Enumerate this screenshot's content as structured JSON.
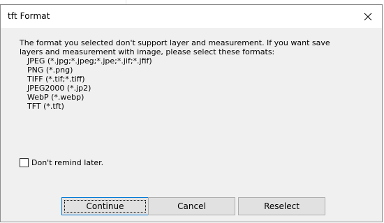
{
  "dialog": {
    "title": "tft Format",
    "message_line1": "The format you selected don't support layer and measurement. If you want save",
    "message_line2": "layers and measurement with image, please select these formats:",
    "formats": [
      "JPEG (*.jpg;*.jpeg;*.jpe;*.jif;*.jfif)",
      "PNG (*.png)",
      "TIFF (*.tif;*.tiff)",
      "JPEG2000 (*.jp2)",
      "WebP (*.webp)",
      "TFT (*.tft)"
    ],
    "checkbox_label": "Don't remind later.",
    "checkbox_checked": false,
    "buttons": {
      "continue": "Continue",
      "cancel": "Cancel",
      "reselect": "Reselect"
    },
    "close_icon": "close-icon"
  }
}
